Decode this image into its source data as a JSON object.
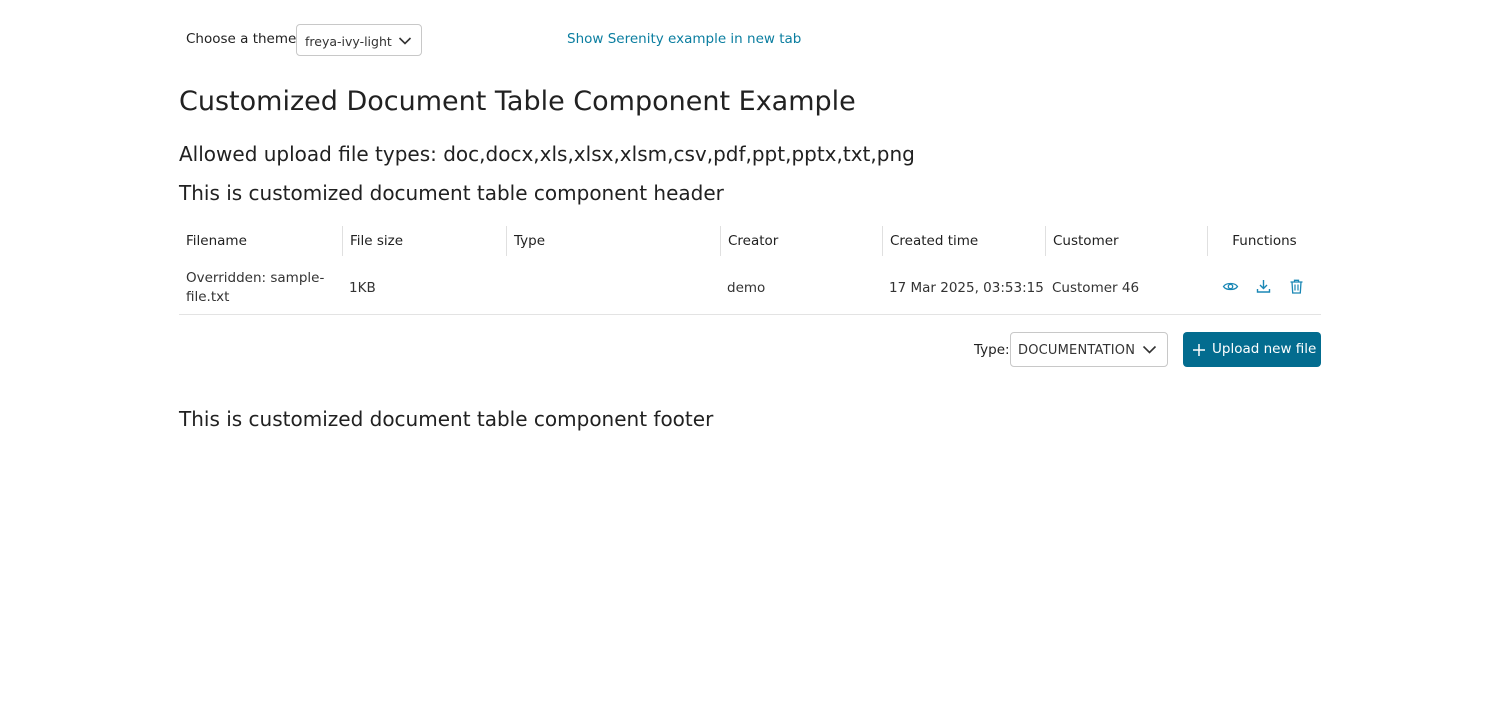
{
  "theme": {
    "label": "Choose a theme",
    "selected": "freya-ivy-light"
  },
  "serenity_link": "Show Serenity example in new tab",
  "page_title": "Customized Document Table Component Example",
  "allowed_types": "Allowed upload file types: doc,docx,xls,xlsx,xlsm,csv,pdf,ppt,pptx,txt,png",
  "table_header_text": "This is customized document table component header",
  "table": {
    "columns": [
      "Filename",
      "File size",
      "Type",
      "Creator",
      "Created time",
      "Customer",
      "Functions"
    ],
    "rows": [
      {
        "filename": "Overridden: sample-file.txt",
        "file_size": "1KB",
        "type": "",
        "creator": "demo",
        "created_time": "17 Mar 2025, 03:53:15",
        "customer": "Customer 46",
        "functions": [
          "eye-icon",
          "download-icon",
          "trash-icon"
        ]
      }
    ]
  },
  "upload": {
    "type_label": "Type:",
    "type_selected": "DOCUMENTATION",
    "button_label": "Upload new file"
  },
  "footer_text": "This is customized document table component footer",
  "colors": {
    "accent": "#036c8f",
    "link": "#0b7ea0",
    "icon": "#1a87b5"
  }
}
